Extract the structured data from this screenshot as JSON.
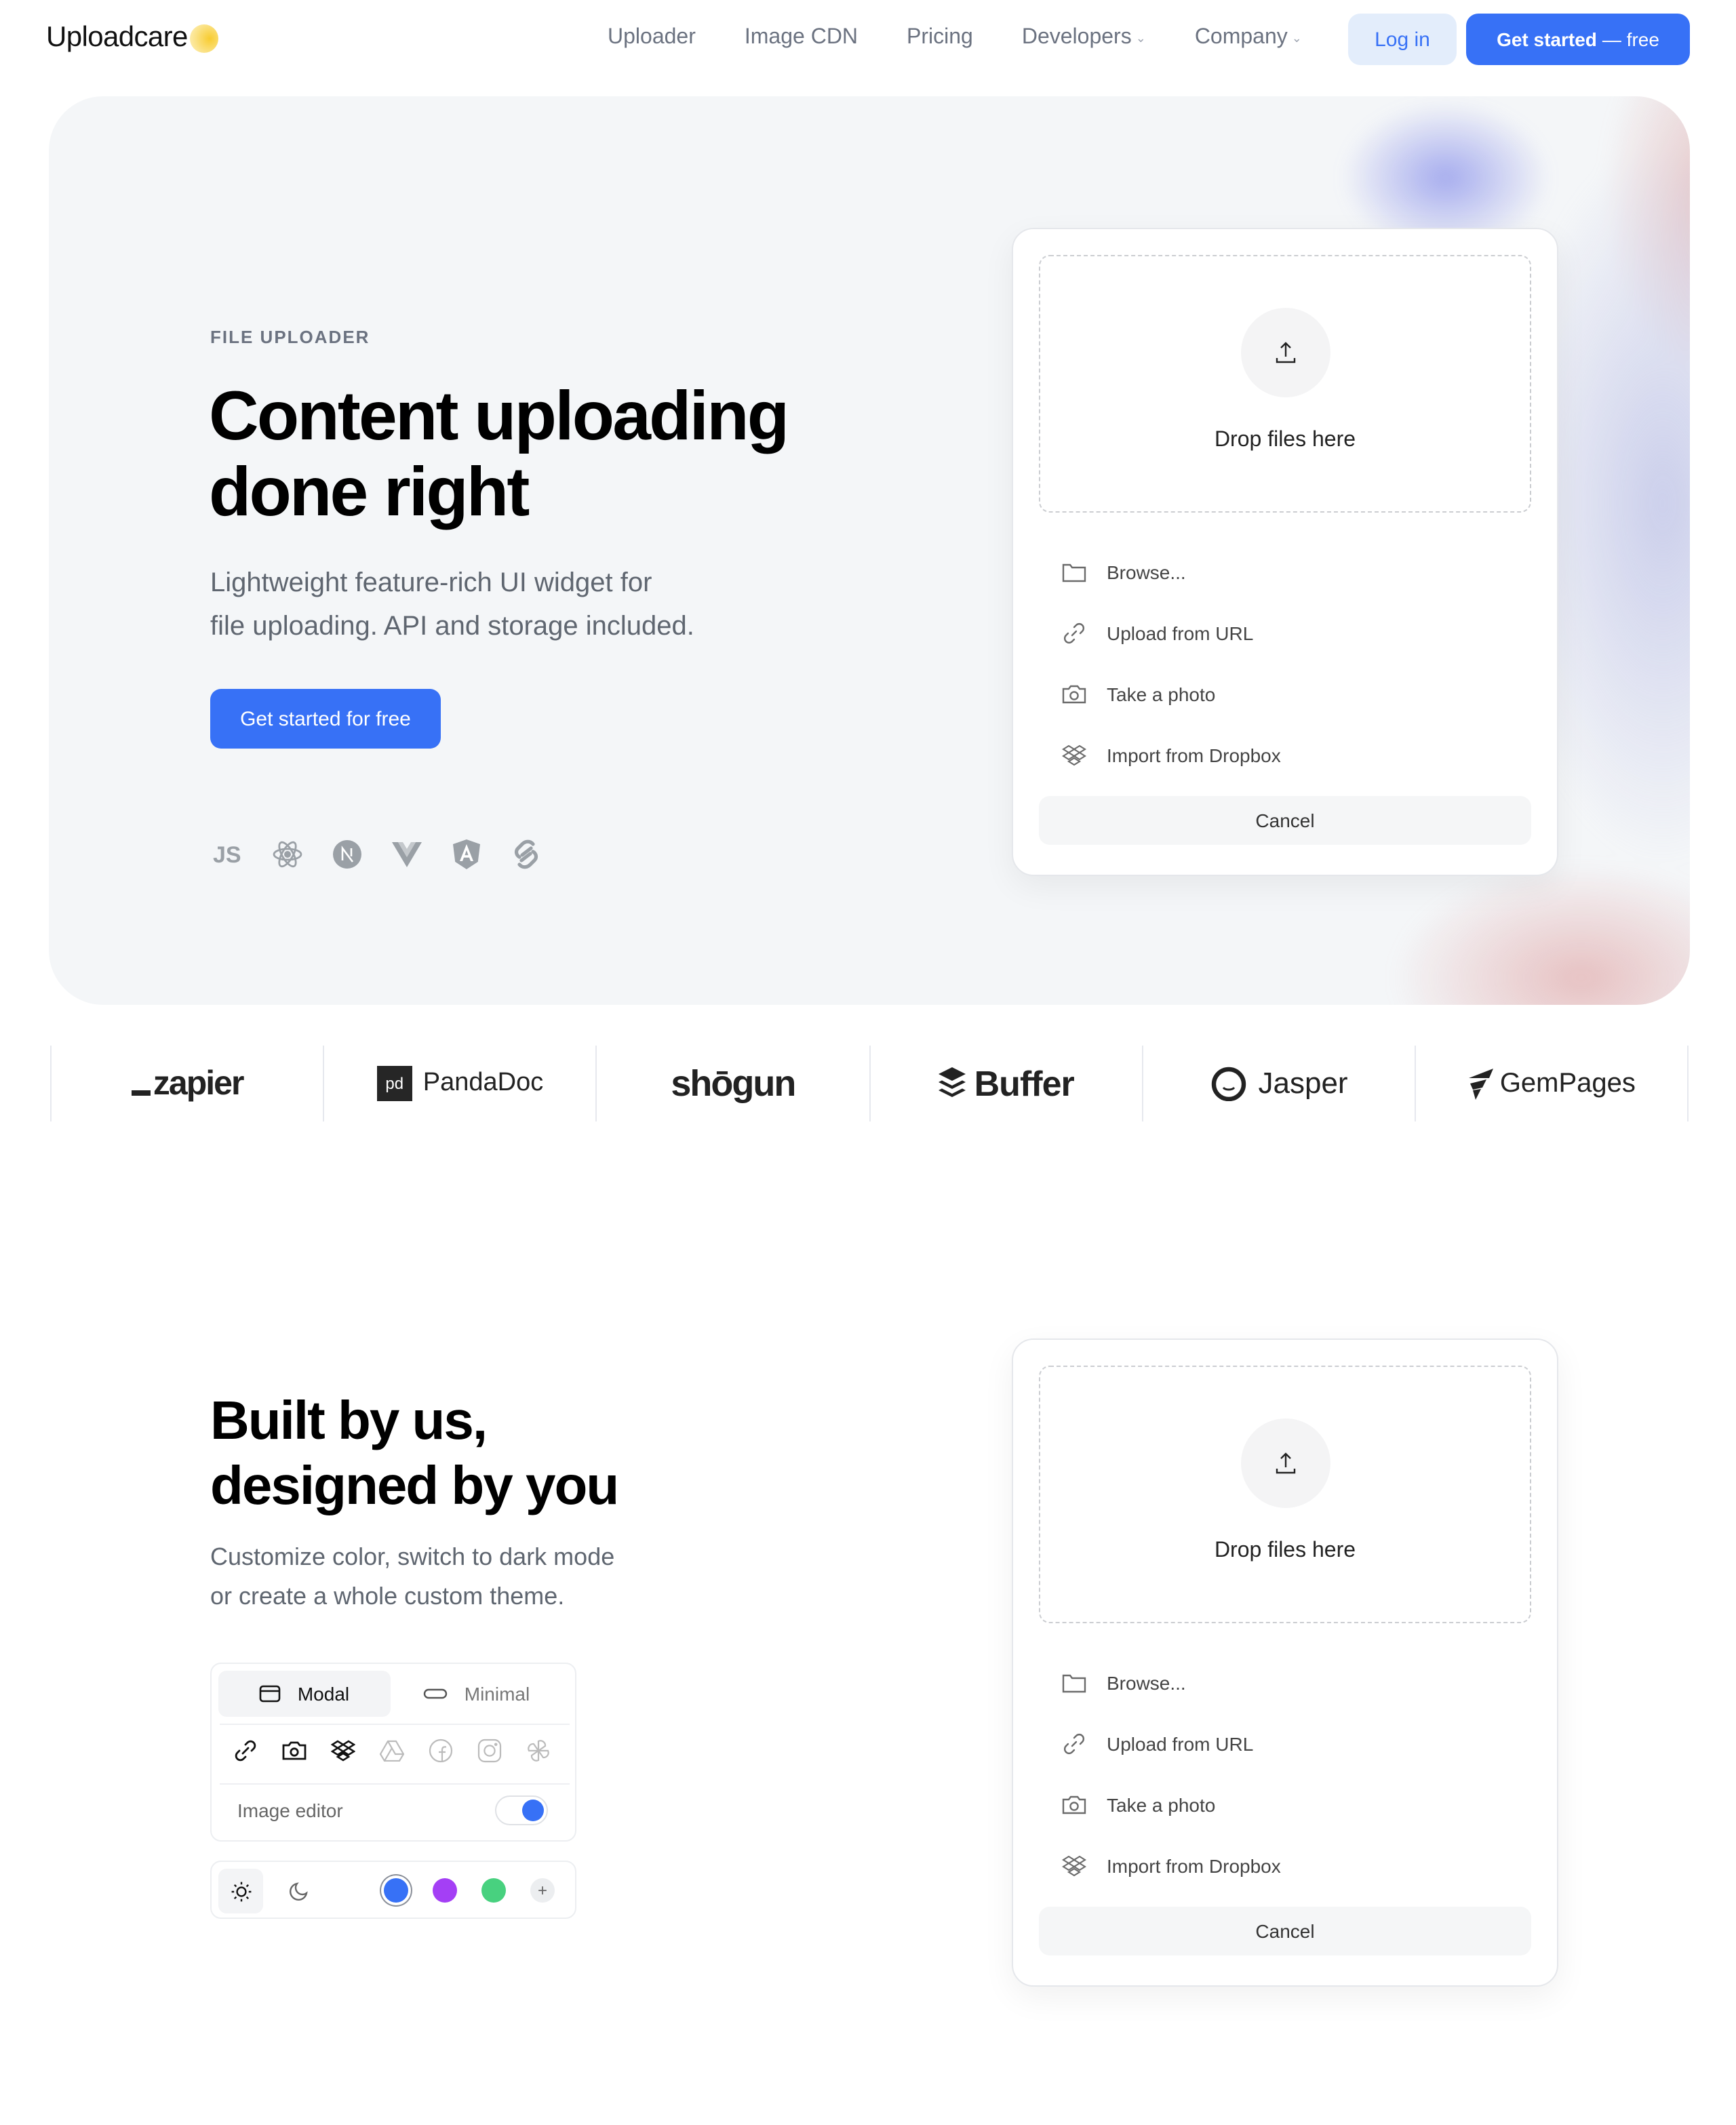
{
  "nav": {
    "logo_text": "Uploadcare",
    "links": [
      {
        "label": "Uploader",
        "dropdown": false
      },
      {
        "label": "Image CDN",
        "dropdown": false
      },
      {
        "label": "Pricing",
        "dropdown": false
      },
      {
        "label": "Developers",
        "dropdown": true
      },
      {
        "label": "Company",
        "dropdown": true
      }
    ],
    "login_label": "Log in",
    "cta_bold": "Get started",
    "cta_rest": "— free"
  },
  "hero": {
    "eyebrow": "FILE UPLOADER",
    "title_line1": "Content uploading",
    "title_line2": "done right",
    "subtitle_line1": "Lightweight feature-rich UI widget for",
    "subtitle_line2": "file uploading. API and storage included.",
    "cta_label": "Get started for free",
    "frameworks": [
      "javascript-icon",
      "react-icon",
      "nextjs-icon",
      "vue-icon",
      "angular-icon",
      "svelte-icon"
    ]
  },
  "uploader": {
    "drop_text": "Drop files here",
    "sources": [
      {
        "icon": "folder-icon",
        "label": "Browse..."
      },
      {
        "icon": "link-icon",
        "label": "Upload from URL"
      },
      {
        "icon": "camera-icon",
        "label": "Take a photo"
      },
      {
        "icon": "dropbox-icon",
        "label": "Import from Dropbox"
      }
    ],
    "cancel_label": "Cancel"
  },
  "customers": [
    "zapier",
    "PandaDoc",
    "shōgun",
    "Buffer",
    "Jasper",
    "GemPages"
  ],
  "customize": {
    "title_line1": "Built by us,",
    "title_line2": "designed by you",
    "subtitle_line1": "Customize color, switch to dark mode",
    "subtitle_line2": "or create a whole custom theme.",
    "modes": [
      {
        "label": "Modal",
        "active": true
      },
      {
        "label": "Minimal",
        "active": false
      }
    ],
    "source_toggles": [
      {
        "icon": "link-icon",
        "enabled": true
      },
      {
        "icon": "camera-icon",
        "enabled": true
      },
      {
        "icon": "dropbox-icon",
        "enabled": true
      },
      {
        "icon": "google-drive-icon",
        "enabled": false
      },
      {
        "icon": "facebook-icon",
        "enabled": false
      },
      {
        "icon": "instagram-icon",
        "enabled": false
      },
      {
        "icon": "pinwheel-icon",
        "enabled": false
      }
    ],
    "image_editor_label": "Image editor",
    "image_editor_enabled": true,
    "theme": "light",
    "colors": [
      {
        "hex": "#3771f6",
        "selected": true
      },
      {
        "hex": "#a43ff5",
        "selected": false
      },
      {
        "hex": "#48d17f",
        "selected": false
      }
    ],
    "add_color_label": "+"
  }
}
